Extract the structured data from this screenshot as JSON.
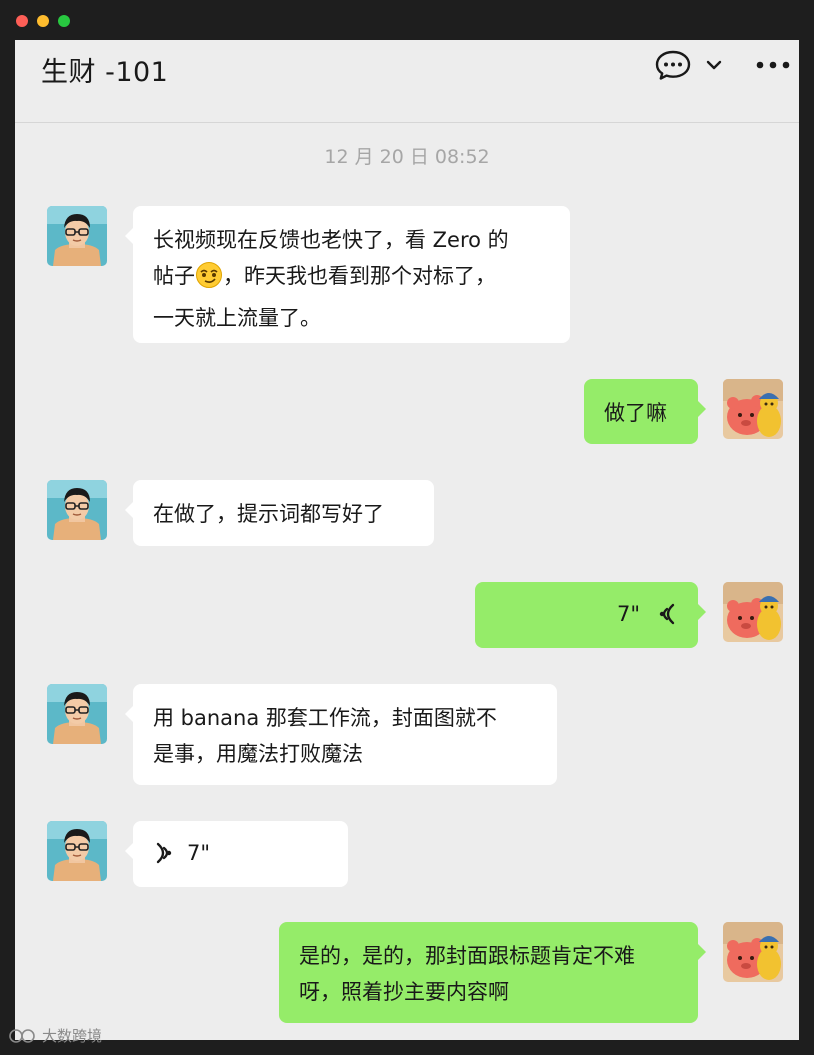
{
  "header": {
    "title": "生财 -101",
    "chat_icon": "chat-bubble-icon",
    "dropdown_icon": "chevron-down-icon",
    "more_icon": "more-icon"
  },
  "timestamp": "12 月 20 日 08:52",
  "messages": [
    {
      "side": "in",
      "type": "text",
      "line1": "长视频现在反馈也老快了，看 Zero 的",
      "line2a": "帖子",
      "line2b": "，昨天我也看到那个对标了，",
      "line3": "一天就上流量了。",
      "emoji": "smirk-emoji"
    },
    {
      "side": "out",
      "type": "text",
      "text": "做了嘛"
    },
    {
      "side": "in",
      "type": "text",
      "text": "在做了，提示词都写好了"
    },
    {
      "side": "out",
      "type": "voice",
      "duration": "7\""
    },
    {
      "side": "in",
      "type": "text",
      "line1": "用 banana 那套工作流，封面图就不",
      "line2": "是事，用魔法打败魔法"
    },
    {
      "side": "in",
      "type": "voice",
      "duration": "7\""
    },
    {
      "side": "out",
      "type": "text",
      "line1": "是的，是的，那封面跟标题肯定不难",
      "line2": "呀，照着抄主要内容啊"
    }
  ],
  "watermark": "大数跨境",
  "colors": {
    "incoming": "#ffffff",
    "outgoing": "#95ec69",
    "background": "#ededed"
  }
}
